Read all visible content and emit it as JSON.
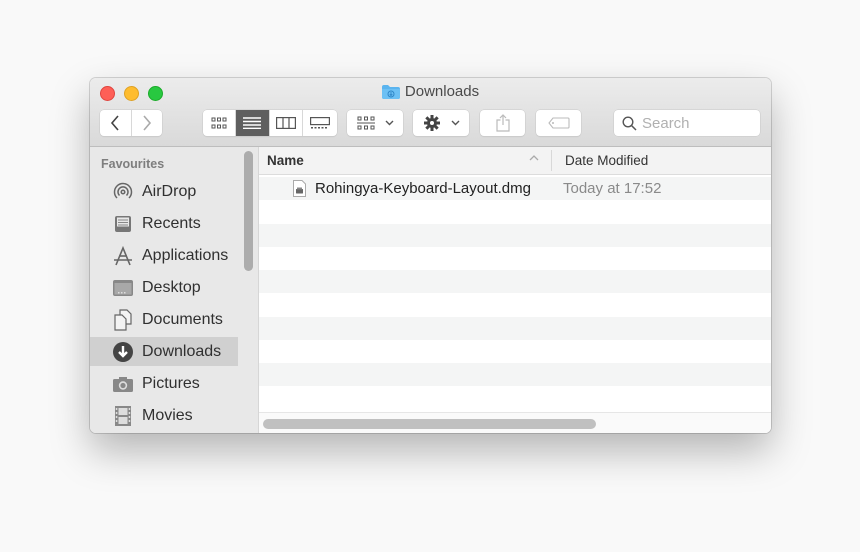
{
  "window": {
    "title": "Downloads",
    "title_icon": "downloads-folder-icon"
  },
  "toolbar": {
    "back_icon": "chevron-left-icon",
    "forward_icon": "chevron-right-icon",
    "view_modes": [
      {
        "name": "icon-view",
        "active": false
      },
      {
        "name": "list-view",
        "active": true
      },
      {
        "name": "column-view",
        "active": false
      },
      {
        "name": "gallery-view",
        "active": false
      }
    ],
    "group_icon": "group-by-icon",
    "action_icon": "gear-icon",
    "share_icon": "share-icon",
    "tag_icon": "tag-icon",
    "search_placeholder": "Search"
  },
  "sidebar": {
    "section": "Favourites",
    "items": [
      {
        "label": "AirDrop",
        "icon": "airdrop-icon",
        "selected": false
      },
      {
        "label": "Recents",
        "icon": "recents-icon",
        "selected": false
      },
      {
        "label": "Applications",
        "icon": "applications-icon",
        "selected": false
      },
      {
        "label": "Desktop",
        "icon": "desktop-icon",
        "selected": false
      },
      {
        "label": "Documents",
        "icon": "documents-icon",
        "selected": false
      },
      {
        "label": "Downloads",
        "icon": "downloads-icon",
        "selected": true
      },
      {
        "label": "Pictures",
        "icon": "pictures-icon",
        "selected": false
      },
      {
        "label": "Movies",
        "icon": "movies-icon",
        "selected": false
      }
    ]
  },
  "file_list": {
    "columns": [
      "Name",
      "Date Modified"
    ],
    "sort_indicator": "^",
    "files": [
      {
        "name": "Rohingya-Keyboard-Layout.dmg",
        "date_modified": "Today at 17:52",
        "icon": "dmg-file-icon"
      }
    ]
  },
  "colors": {
    "close": "#fe5f57",
    "minimize": "#febc2e",
    "maximize": "#28c840",
    "folder_blue": "#5ab4ef",
    "selected_sidebar": "#d0d0d0"
  }
}
